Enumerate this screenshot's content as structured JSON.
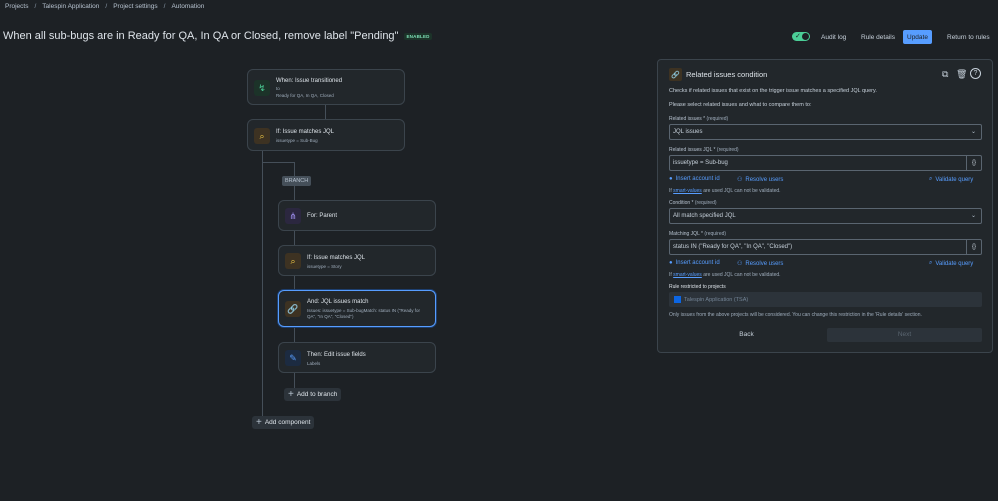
{
  "breadcrumb": [
    "Projects",
    "Talespin Application",
    "Project settings",
    "Automation"
  ],
  "rule": {
    "title": "When all sub-bugs are in Ready for QA, In QA or Closed, remove label \"Pending\"",
    "status_badge": "ENABLED"
  },
  "header": {
    "audit_log": "Audit log",
    "rule_details": "Rule details",
    "update": "Update",
    "return": "Return to rules"
  },
  "flow": {
    "trigger": {
      "title": "When: Issue transitioned",
      "to": "to",
      "sub": "Ready for QA, In QA, Closed"
    },
    "condition1": {
      "title": "If: Issue matches JQL",
      "sub": "issuetype = Sub-Bug"
    },
    "branch_label": "BRANCH",
    "for": {
      "title": "For: Parent"
    },
    "condition2": {
      "title": "If: Issue matches JQL",
      "sub": "issuetype = Story"
    },
    "and": {
      "title": "And: JQL issues match",
      "sub1": "Issues: issuetype = Sub-bugMatch: status IN (\"Ready for",
      "sub2": "QA\", \"In QA\", \"Closed\")"
    },
    "action": {
      "title": "Then: Edit issue fields",
      "sub": "Labels"
    },
    "add_to_branch": "Add to branch",
    "add_component": "Add component"
  },
  "panel": {
    "title": "Related issues condition",
    "desc1": "Checks if related issues that exist on the trigger issue matches a specified JQL query.",
    "desc2": "Please select related issues and what to compare them to:",
    "related_label": "Related issues *",
    "related_req": "(required)",
    "related_value": "JQL issues",
    "jql_label": "Related issues JQL *",
    "jql_req": "(required)",
    "jql_value": "issuetype = Sub-bug",
    "insert_account": "Insert account id",
    "resolve_users": "Resolve users",
    "validate_query": "Validate query",
    "smart_note_pre": "If",
    "smart_note_link": "smart-values",
    "smart_note_post": "are used JQL can not be validated.",
    "condition_label": "Condition *",
    "condition_req": "(required)",
    "condition_value": "All match specified JQL",
    "matching_label": "Matching JQL *",
    "matching_req": "(required)",
    "matching_value": "status IN (\"Ready for QA\", \"In QA\", \"Closed\")",
    "restricted_label": "Rule restricted to projects",
    "restricted_value": "Talespin Application (TSA)",
    "restricted_note": "Only issues from the above projects will be considered. You can change this restriction in the 'Rule details' section.",
    "back": "Back",
    "next": "Next"
  },
  "colors": {
    "accent": "#579dff",
    "enabled": "#4bce97",
    "background": "#1d2125"
  }
}
